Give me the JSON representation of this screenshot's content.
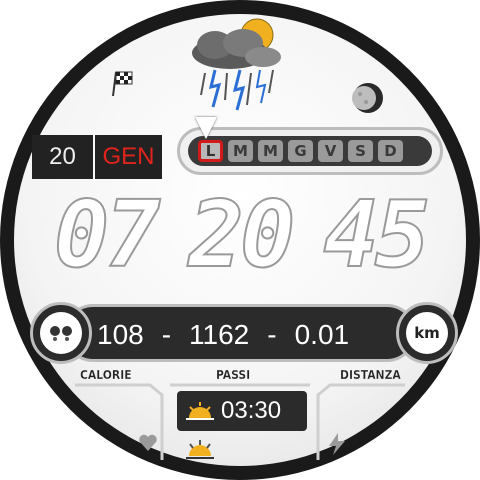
{
  "date": {
    "day": "20",
    "month": "GEN"
  },
  "weekdays": [
    "L",
    "M",
    "M",
    "G",
    "V",
    "S",
    "D"
  ],
  "active_weekday_index": 0,
  "time": {
    "hours": "07",
    "minutes": "20",
    "seconds": "45"
  },
  "stats": {
    "calories": "108",
    "steps": "1162",
    "distance": "0.01",
    "separator": "-"
  },
  "stat_labels": {
    "calories": "CALORIE",
    "steps": "PASSI",
    "distance": "DISTANZA"
  },
  "sunrise": {
    "time": "03:30"
  },
  "units": {
    "distance": "km"
  },
  "icons": {
    "weather": "storm-cloud-sun-icon",
    "flag": "checkered-flag-icon",
    "moon": "moon-phase-icon",
    "calories": "footprints-icon",
    "distance": "km-icon",
    "heart": "heart-icon",
    "bolt": "lightning-icon",
    "sunrise": "sunrise-icon",
    "sunset": "sunset-icon"
  },
  "colors": {
    "accent": "#e0241b",
    "panel": "#2b2b2b"
  }
}
